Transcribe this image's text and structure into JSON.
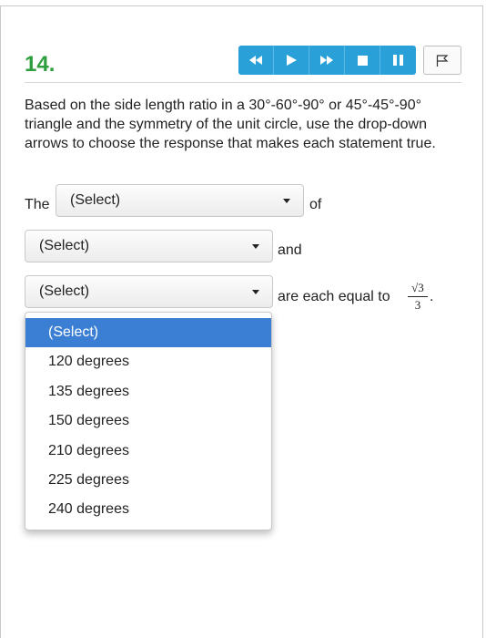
{
  "question": {
    "number": "14.",
    "prompt": "Based on the side length ratio in a 30°-60°-90° or 45°-45°-90° triangle and the symmetry of the unit circle, use the drop-down arrows to choose the response that makes each statement true."
  },
  "toolbar": {
    "buttons": [
      "rewind-icon",
      "play-icon",
      "fast-forward-icon",
      "stop-icon",
      "pause-icon"
    ],
    "flag_icon": "flag-icon",
    "accent_color": "#2aa0d8"
  },
  "statement": {
    "word_the": "The",
    "word_of": "of",
    "word_and": "and",
    "word_equal": "are each equal to",
    "frac_num": "√3",
    "frac_den": "3",
    "period": "."
  },
  "selects": {
    "first": "(Select)",
    "second": "(Select)",
    "third": "(Select)"
  },
  "dropdown": {
    "options": [
      "(Select)",
      "120 degrees",
      "135 degrees",
      "150 degrees",
      "210 degrees",
      "225 degrees",
      "240 degrees"
    ],
    "selected_index": 0,
    "highlight_color": "#3b7fd4"
  }
}
